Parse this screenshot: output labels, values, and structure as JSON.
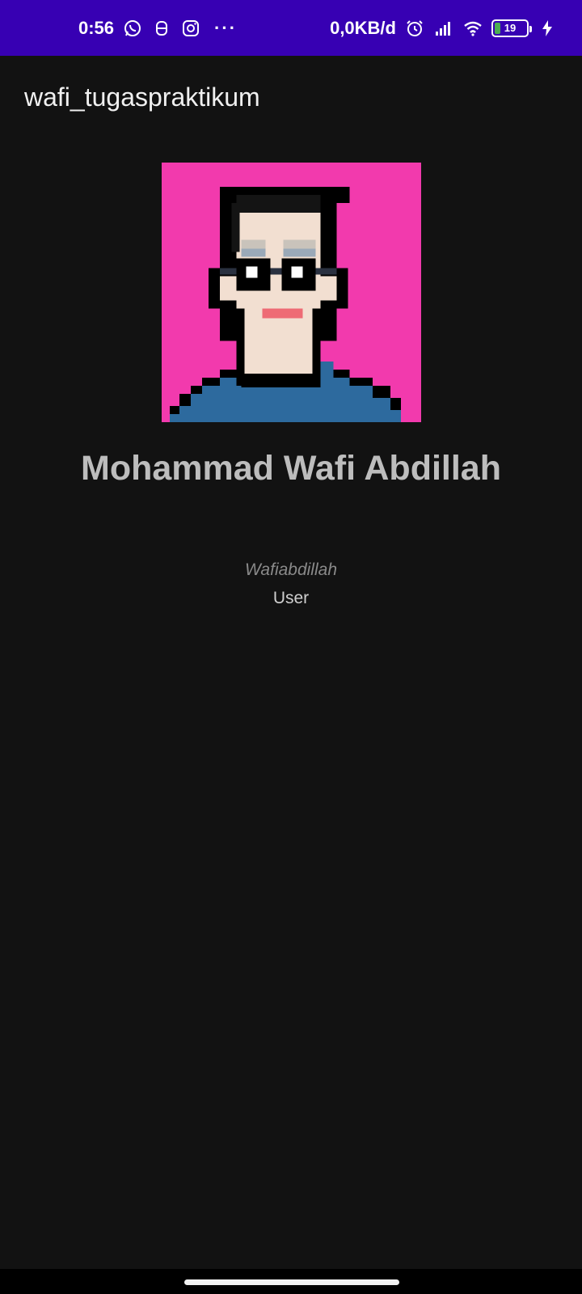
{
  "status_bar": {
    "time": "0:56",
    "notification_icons": [
      "whatsapp-icon",
      "notification-icon",
      "instagram-icon"
    ],
    "more": "···",
    "net_speed": "0,0KB/d",
    "battery": "19",
    "battery_level": 0.19,
    "status_color": "#3700b3"
  },
  "app_bar": {
    "title": "wafi_tugaspraktikum"
  },
  "profile": {
    "name": "Mohammad Wafi Abdillah",
    "username": "Wafiabdillah",
    "role": "User",
    "avatar_bg": "#f23aad"
  }
}
